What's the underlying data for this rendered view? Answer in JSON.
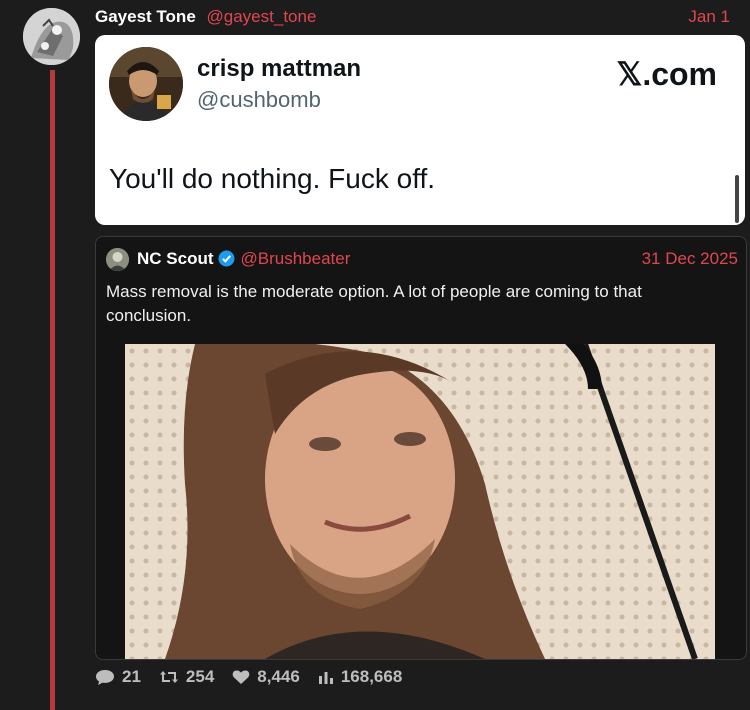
{
  "post": {
    "author_name": "Gayest Tone",
    "author_handle": "@gayest_tone",
    "date": "Jan 1"
  },
  "embed": {
    "name": "crisp mattman",
    "handle": "@cushbomb",
    "site": "𝕏.com",
    "text": "You'll do nothing. Fuck off."
  },
  "quote": {
    "name": "NC Scout",
    "handle": "@Brushbeater",
    "date": "31 Dec 2025",
    "text": "Mass removal is the moderate option. A lot of people are coming to that conclusion."
  },
  "stats": {
    "replies": "21",
    "reposts": "254",
    "likes": "8,446",
    "views": "168,668"
  },
  "colors": {
    "accent": "#e0464f",
    "thread_line": "#b23b3b",
    "background": "#1c1c1c",
    "verified": "#1d9bf0"
  },
  "icons": [
    "reply-icon",
    "repost-icon",
    "like-icon",
    "views-icon",
    "verified-icon"
  ]
}
